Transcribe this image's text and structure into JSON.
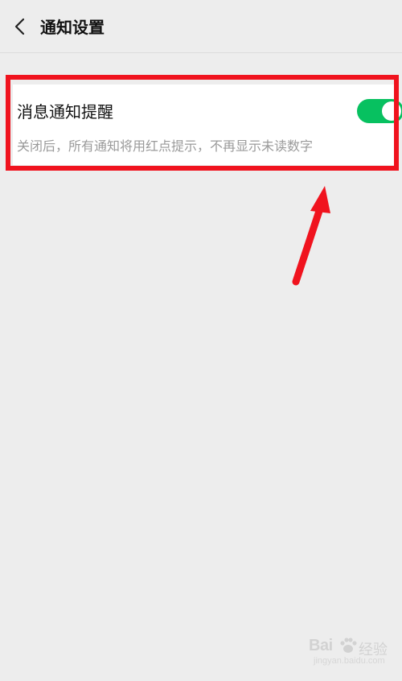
{
  "header": {
    "title": "通知设置",
    "back_icon": "chevron-left-icon"
  },
  "setting": {
    "title": "消息通知提醒",
    "description": "关闭后，所有通知将用红点提示，不再显示未读数字",
    "toggle_state": "on"
  },
  "colors": {
    "background": "#ededed",
    "card": "#ffffff",
    "toggle_on": "#07c160",
    "annotation_red": "#f0131e"
  },
  "annotation": {
    "highlight_box": "red-rectangle",
    "arrow": "red-arrow"
  },
  "watermark": {
    "brand": "Bai",
    "brand_cn": "经验",
    "url": "jingyan.baidu.com"
  }
}
